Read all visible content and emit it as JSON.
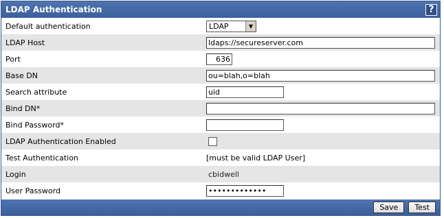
{
  "title": "LDAP Authentication",
  "help_symbol": "?",
  "labels": {
    "default_auth": "Default authentication",
    "ldap_host": "LDAP Host",
    "port": "Port",
    "base_dn": "Base DN",
    "search_attr": "Search attribute",
    "bind_dn": "Bind DN*",
    "bind_password": "Bind Password*",
    "ldap_enabled": "LDAP Authentication Enabled",
    "test_auth": "Test Authentication",
    "login": "Login",
    "user_password": "User Password"
  },
  "values": {
    "default_auth": "LDAP",
    "ldap_host": "ldaps://secureserver.com",
    "port": "636",
    "base_dn": "ou=blah,o=blah",
    "search_attr": "uid",
    "bind_dn": "",
    "bind_password": "",
    "ldap_enabled": false,
    "test_note": "[must be valid LDAP User]",
    "login": "cbidwell",
    "user_password": "•••••••••••••"
  },
  "buttons": {
    "save": "Save",
    "test": "Test"
  }
}
